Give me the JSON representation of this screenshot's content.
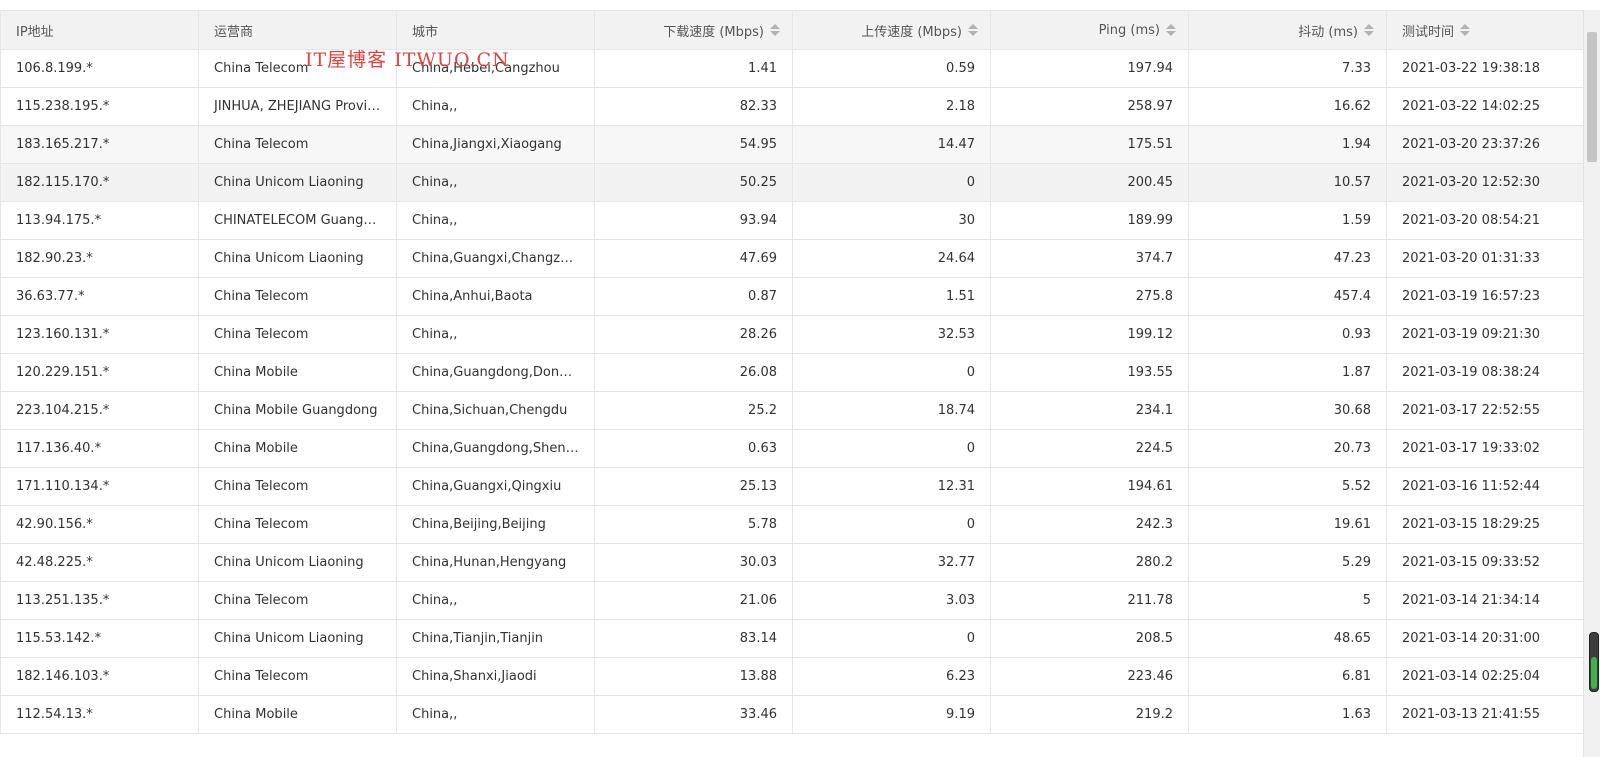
{
  "table": {
    "columns": [
      {
        "label": "IP地址",
        "sortable": false
      },
      {
        "label": "运营商",
        "sortable": false
      },
      {
        "label": "城市",
        "sortable": false
      },
      {
        "label": "下载速度 (Mbps)",
        "sortable": true
      },
      {
        "label": "上传速度 (Mbps)",
        "sortable": true
      },
      {
        "label": "Ping (ms)",
        "sortable": true
      },
      {
        "label": "抖动 (ms)",
        "sortable": true
      },
      {
        "label": "测试时间",
        "sortable": true
      }
    ],
    "rows": [
      [
        "106.8.199.*",
        "China Telecom",
        "China,Hebei,Cangzhou",
        "1.41",
        "0.59",
        "197.94",
        "7.33",
        "2021-03-22 19:38:18"
      ],
      [
        "115.238.195.*",
        "JINHUA, ZHEJIANG Province, NETWORK",
        "China,,",
        "82.33",
        "2.18",
        "258.97",
        "16.62",
        "2021-03-22 14:02:25"
      ],
      [
        "183.165.217.*",
        "China Telecom",
        "China,Jiangxi,Xiaogang",
        "54.95",
        "14.47",
        "175.51",
        "1.94",
        "2021-03-20 23:37:26"
      ],
      [
        "182.115.170.*",
        "China Unicom Liaoning",
        "China,,",
        "50.25",
        "0",
        "200.45",
        "10.57",
        "2021-03-20 12:52:30"
      ],
      [
        "113.94.175.*",
        "CHINATELECOM Guangdong",
        "China,,",
        "93.94",
        "30",
        "189.99",
        "1.59",
        "2021-03-20 08:54:21"
      ],
      [
        "182.90.23.*",
        "China Unicom Liaoning",
        "China,Guangxi,Changzhou",
        "47.69",
        "24.64",
        "374.7",
        "47.23",
        "2021-03-20 01:31:33"
      ],
      [
        "36.63.77.*",
        "China Telecom",
        "China,Anhui,Baota",
        "0.87",
        "1.51",
        "275.8",
        "457.4",
        "2021-03-19 16:57:23"
      ],
      [
        "123.160.131.*",
        "China Telecom",
        "China,,",
        "28.26",
        "32.53",
        "199.12",
        "0.93",
        "2021-03-19 09:21:30"
      ],
      [
        "120.229.151.*",
        "China Mobile",
        "China,Guangdong,Dongguan",
        "26.08",
        "0",
        "193.55",
        "1.87",
        "2021-03-19 08:38:24"
      ],
      [
        "223.104.215.*",
        "China Mobile Guangdong",
        "China,Sichuan,Chengdu",
        "25.2",
        "18.74",
        "234.1",
        "30.68",
        "2021-03-17 22:52:55"
      ],
      [
        "117.136.40.*",
        "China Mobile",
        "China,Guangdong,Shenzhen",
        "0.63",
        "0",
        "224.5",
        "20.73",
        "2021-03-17 19:33:02"
      ],
      [
        "171.110.134.*",
        "China Telecom",
        "China,Guangxi,Qingxiu",
        "25.13",
        "12.31",
        "194.61",
        "5.52",
        "2021-03-16 11:52:44"
      ],
      [
        "42.90.156.*",
        "China Telecom",
        "China,Beijing,Beijing",
        "5.78",
        "0",
        "242.3",
        "19.61",
        "2021-03-15 18:29:25"
      ],
      [
        "42.48.225.*",
        "China Unicom Liaoning",
        "China,Hunan,Hengyang",
        "30.03",
        "32.77",
        "280.2",
        "5.29",
        "2021-03-15 09:33:52"
      ],
      [
        "113.251.135.*",
        "China Telecom",
        "China,,",
        "21.06",
        "3.03",
        "211.78",
        "5",
        "2021-03-14 21:34:14"
      ],
      [
        "115.53.142.*",
        "China Unicom Liaoning",
        "China,Tianjin,Tianjin",
        "83.14",
        "0",
        "208.5",
        "48.65",
        "2021-03-14 20:31:00"
      ],
      [
        "182.146.103.*",
        "China Telecom",
        "China,Shanxi,Jiaodi",
        "13.88",
        "6.23",
        "223.46",
        "6.81",
        "2021-03-14 02:25:04"
      ],
      [
        "112.54.13.*",
        "China Mobile",
        "China,,",
        "33.46",
        "9.19",
        "219.2",
        "1.63",
        "2021-03-13 21:41:55"
      ]
    ],
    "hover_row_index": 3
  },
  "watermark": {
    "text": "IT屋博客 ITWUO.CN"
  },
  "colors": {
    "header_bg": "#f2f2f2",
    "border": "#e6e6e6",
    "alt_row_bg": "#f7f7f7",
    "watermark": "#e53935",
    "side_widget_fill": "#3fb24a"
  }
}
